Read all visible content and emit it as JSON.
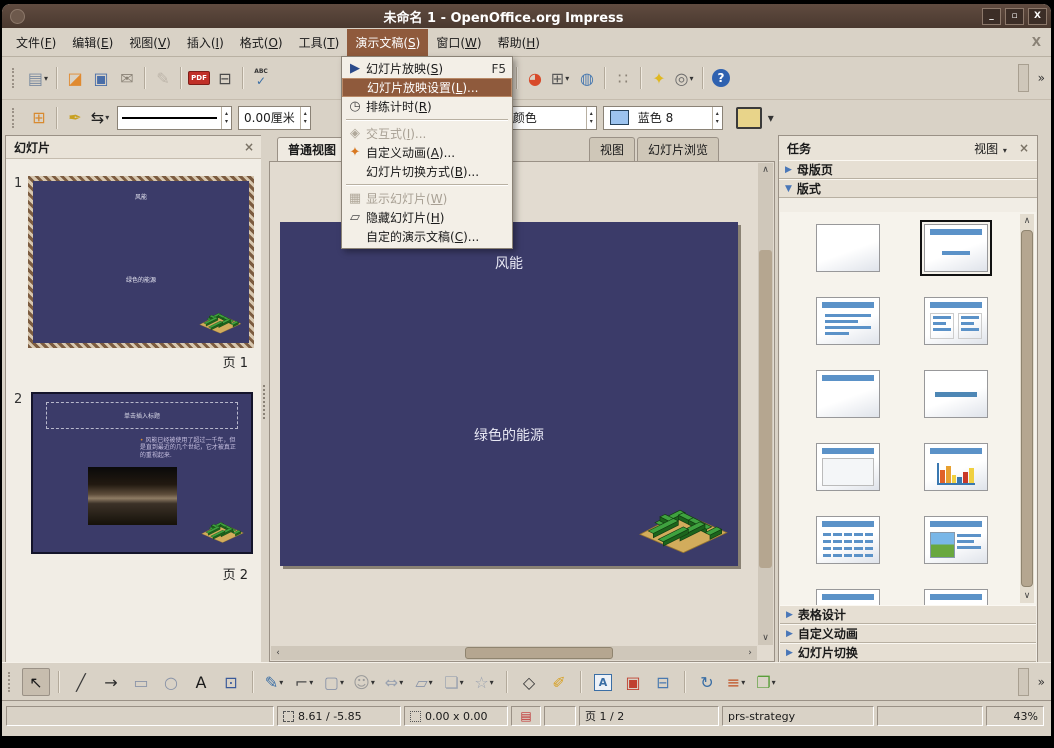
{
  "window": {
    "title": "未命名 1 - OpenOffice.org Impress",
    "buttons": {
      "minimize": "_",
      "maximize": "▫",
      "close": "X"
    }
  },
  "menubar": {
    "close_label": "X",
    "items": [
      {
        "pre": "文件(",
        "key": "F",
        "post": ")"
      },
      {
        "pre": "编辑(",
        "key": "E",
        "post": ")"
      },
      {
        "pre": "视图(",
        "key": "V",
        "post": ")"
      },
      {
        "pre": "插入(",
        "key": "I",
        "post": ")"
      },
      {
        "pre": "格式(",
        "key": "O",
        "post": ")"
      },
      {
        "pre": "工具(",
        "key": "T",
        "post": ")"
      },
      {
        "pre": "演示文稿(",
        "key": "S",
        "post": ")",
        "active": true
      },
      {
        "pre": "窗口(",
        "key": "W",
        "post": ")"
      },
      {
        "pre": "帮助(",
        "key": "H",
        "post": ")"
      }
    ]
  },
  "popup": {
    "items": [
      {
        "pre": "幻灯片放映(",
        "key": "S",
        "post": ")",
        "shortcut": "F5",
        "icon": "slideshow-icon"
      },
      {
        "pre": "幻灯片放映设置(",
        "key": "L",
        "post": ")...",
        "highlight": true
      },
      {
        "pre": "排练计时(",
        "key": "R",
        "post": ")",
        "icon": "timer-icon"
      },
      {
        "sep": true
      },
      {
        "pre": "交互式(",
        "key": "I",
        "post": ")...",
        "disabled": true,
        "icon": "interaction-icon"
      },
      {
        "pre": "自定义动画(",
        "key": "A",
        "post": ")...",
        "icon": "animation-icon"
      },
      {
        "pre": "幻灯片切换方式(",
        "key": "B",
        "post": ")..."
      },
      {
        "sep": true
      },
      {
        "pre": "显示幻灯片(",
        "key": "W",
        "post": ")",
        "disabled": true,
        "icon": "show-slide-icon"
      },
      {
        "pre": "隐藏幻灯片(",
        "key": "H",
        "post": ")",
        "icon": "hide-slide-icon"
      },
      {
        "pre": "自定的演示文稿(",
        "key": "C",
        "post": ")..."
      }
    ]
  },
  "toolbar_main": {
    "icons": [
      {
        "name": "new-document-icon",
        "dropdown": true
      },
      {
        "sep": true
      },
      {
        "name": "open-icon"
      },
      {
        "name": "save-icon"
      },
      {
        "name": "email-icon"
      },
      {
        "sep": true
      },
      {
        "name": "edit-file-icon",
        "disabled": true
      },
      {
        "sep": true
      },
      {
        "name": "pdf-export-icon"
      },
      {
        "name": "print-icon"
      },
      {
        "sep": true
      },
      {
        "name": "spellcheck-icon"
      },
      {
        "gap": 186
      },
      {
        "name": "undo-icon",
        "dropdown": true
      },
      {
        "name": "redo-icon",
        "dropdown": true
      },
      {
        "sep": true
      },
      {
        "name": "chart-icon"
      },
      {
        "name": "table-icon",
        "dropdown": true
      },
      {
        "name": "hyperlink-icon"
      },
      {
        "sep": true
      },
      {
        "name": "display-grid-icon"
      },
      {
        "sep": true
      },
      {
        "name": "navigator-icon"
      },
      {
        "name": "zoom-icon",
        "dropdown": true
      },
      {
        "sep": true
      },
      {
        "name": "help-icon"
      }
    ],
    "overflow": "»"
  },
  "toolbar_line": {
    "line_width": "0.00厘米",
    "fill_type": "颜色",
    "line_color": "蓝色 8",
    "overflow": "▾"
  },
  "slides_panel": {
    "title": "幻灯片",
    "close_label": "×",
    "slides": [
      {
        "num": "1",
        "label": "页 1",
        "title": "风能",
        "subtitle": "绿色的能源"
      },
      {
        "num": "2",
        "label": "页 2",
        "placeholder": "单击插入标题",
        "bullet": "•",
        "body": "风能已经被使用了超过一千年，但是直到最近的几个世纪，它才被真正的重视起来."
      }
    ]
  },
  "workspace": {
    "tabs": [
      {
        "label": "普通视图",
        "active": true
      },
      {
        "label": "视图",
        "active": false
      },
      {
        "label": "幻灯片浏览",
        "active": false
      }
    ],
    "slide": {
      "title": "风能",
      "subtitle": "绿色的能源"
    }
  },
  "tasks": {
    "title": "任务",
    "view_label": "视图",
    "close_label": "×",
    "sections": [
      {
        "label": "母版页",
        "expanded": false
      },
      {
        "label": "版式",
        "expanded": true
      },
      {
        "label": "表格设计",
        "expanded": false
      },
      {
        "label": "自定义动画",
        "expanded": false
      },
      {
        "label": "幻灯片切换",
        "expanded": false
      }
    ],
    "layouts": [
      {
        "name": "blank"
      },
      {
        "name": "title-subtitle",
        "selected": true
      },
      {
        "name": "title-content"
      },
      {
        "name": "title-two-content"
      },
      {
        "name": "title-only"
      },
      {
        "name": "centered-text"
      },
      {
        "name": "title-content-frame"
      },
      {
        "name": "title-chart"
      },
      {
        "name": "title-table"
      },
      {
        "name": "title-clipart-text"
      },
      {
        "name": "title-text-chart"
      },
      {
        "name": "title-text-clipart"
      }
    ]
  },
  "drawing_toolbar": {
    "icons": [
      {
        "name": "select-icon",
        "pressed": true
      },
      {
        "sep": true
      },
      {
        "name": "line-icon"
      },
      {
        "name": "arrow-icon"
      },
      {
        "name": "rectangle-icon"
      },
      {
        "name": "ellipse-icon"
      },
      {
        "name": "text-icon"
      },
      {
        "name": "vertical-text-icon"
      },
      {
        "sep": true
      },
      {
        "name": "curve-icon",
        "dropdown": true
      },
      {
        "name": "connector-icon",
        "dropdown": true
      },
      {
        "name": "basic-shapes-icon",
        "dropdown": true
      },
      {
        "name": "symbol-shapes-icon",
        "dropdown": true
      },
      {
        "name": "block-arrows-icon",
        "dropdown": true
      },
      {
        "name": "flowchart-icon",
        "dropdown": true
      },
      {
        "name": "callout-icon",
        "dropdown": true
      },
      {
        "name": "star-icon",
        "dropdown": true
      },
      {
        "sep": true
      },
      {
        "name": "edit-points-icon"
      },
      {
        "name": "gluepoints-icon"
      },
      {
        "sep": true
      },
      {
        "name": "fontwork-icon"
      },
      {
        "name": "image-icon"
      },
      {
        "name": "gallery-icon"
      },
      {
        "sep": true
      },
      {
        "name": "rotate-icon"
      },
      {
        "name": "align-icon",
        "dropdown": true
      },
      {
        "name": "arrange-icon",
        "dropdown": true
      }
    ],
    "overflow": "»"
  },
  "statusbar": {
    "position": "8.61 / -5.85",
    "size": "0.00 x 0.00",
    "page": "页 1 / 2",
    "template": "prs-strategy",
    "zoom": "43%"
  }
}
